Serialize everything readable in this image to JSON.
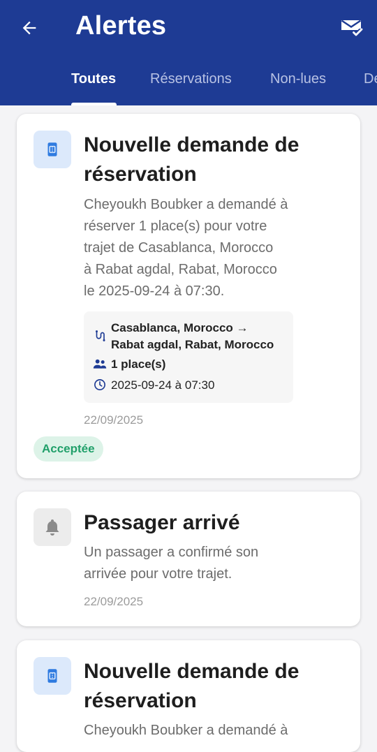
{
  "header": {
    "title": "Alertes",
    "tabs": [
      "Toutes",
      "Réservations",
      "Non-lues",
      "De"
    ],
    "active_tab": "Toutes"
  },
  "notifications": [
    {
      "icon": "ticket-icon",
      "title_line1": "Nouvelle demande de",
      "title_line2": "réservation",
      "body_lines": [
        "Cheyoukh Boubker a demandé à",
        "réserver 1 place(s) pour votre",
        "trajet de Casablanca, Morocco",
        "à Rabat agdal, Rabat, Morocco",
        "le 2025-09-24 à 07:30."
      ],
      "route_line1": "Casablanca, Morocco →",
      "route_line2": "Rabat agdal, Rabat, Morocco",
      "seats": "1 place(s)",
      "datetime": "2025-09-24 à 07:30",
      "date": "22/09/2025",
      "status": "Acceptée"
    },
    {
      "icon": "bell-icon",
      "title": "Passager arrivé",
      "body_lines": [
        "Un passager a confirmé son",
        "arrivée pour votre trajet."
      ],
      "date": "22/09/2025"
    },
    {
      "icon": "ticket-icon",
      "title_line1": "Nouvelle demande de",
      "title_line2": "réservation",
      "body_lines": [
        "Cheyoukh Boubker a demandé à"
      ]
    }
  ],
  "colors": {
    "header_bg": "#1e3b94",
    "accent_blue": "#2f7be0",
    "badge_bg": "#ddf3e8",
    "badge_text": "#21a06a"
  }
}
